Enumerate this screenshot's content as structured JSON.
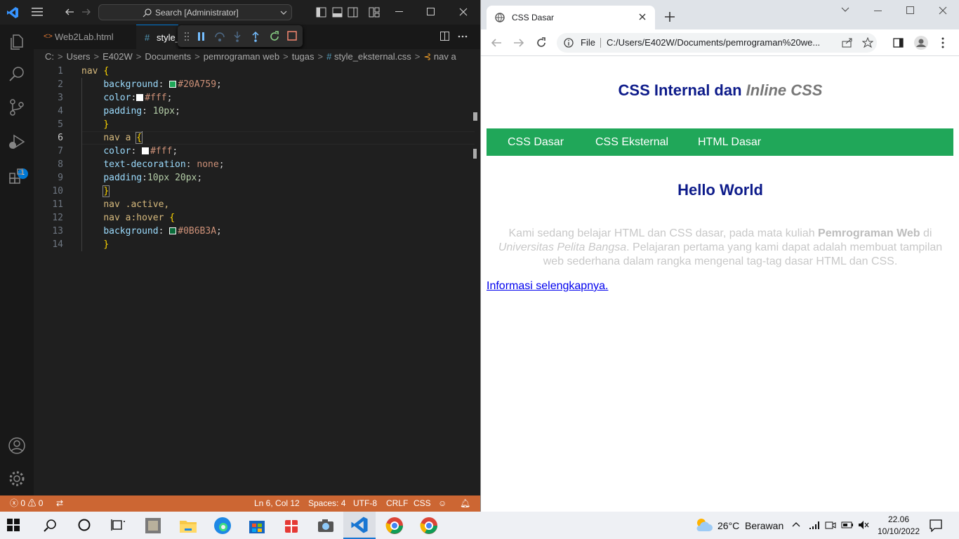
{
  "vscode": {
    "search_placeholder": "Search [Administrator]",
    "debug_badge": "1",
    "tabs": [
      {
        "label": "Web2Lab.html",
        "icon": "<>"
      },
      {
        "label": "style_",
        "icon": "#"
      }
    ],
    "breadcrumb": [
      "C:",
      "Users",
      "E402W",
      "Documents",
      "pemrograman web",
      "tugas",
      "style_eksternal.css",
      "nav a"
    ],
    "code_lines": [
      {
        "n": "1"
      },
      {
        "n": "2"
      },
      {
        "n": "3"
      },
      {
        "n": "4"
      },
      {
        "n": "5"
      },
      {
        "n": "6"
      },
      {
        "n": "7"
      },
      {
        "n": "8"
      },
      {
        "n": "9"
      },
      {
        "n": "10"
      },
      {
        "n": "11"
      },
      {
        "n": "12"
      },
      {
        "n": "13"
      },
      {
        "n": "14"
      }
    ],
    "code": {
      "l1_sel": "nav",
      "l1_br": "{",
      "l2_prop": "background",
      "l2_val": "#20A759",
      "l2_swatch": "#20A759",
      "l3_prop": "color",
      "l3_val": "#fff",
      "l3_swatch": "#ffffff",
      "l4_prop": "padding",
      "l4_val": "10px",
      "l5_br": "}",
      "l6_sel": "nav a",
      "l6_br": "{",
      "l7_prop": "color",
      "l7_val": "#fff",
      "l7_swatch": "#ffffff",
      "l8_prop": "text-decoration",
      "l8_val": "none",
      "l9_prop": "padding",
      "l9_val": "10px 20px",
      "l10_br": "}",
      "l11_sel": "nav .active,",
      "l12_sel": "nav a:hover",
      "l12_br": "{",
      "l13_prop": "background",
      "l13_val": "#0B6B3A",
      "l13_swatch": "#0B6B3A",
      "l14_br": "}"
    },
    "status": {
      "errors": "0",
      "warnings": "0",
      "position": "Ln 6, Col 12",
      "spaces": "Spaces: 4",
      "encoding": "UTF-8",
      "eol": "CRLF",
      "language": "CSS",
      "bar_color": "#cc6633"
    }
  },
  "browser": {
    "tab_title": "CSS Dasar",
    "omnibox_prefix": "File",
    "url": "C:/Users/E402W/Documents/pemrograman%20we...",
    "page": {
      "h1_normal": "CSS Internal dan ",
      "h1_italic": "Inline CSS",
      "nav": [
        "CSS Dasar",
        "CSS Eksternal",
        "HTML Dasar"
      ],
      "nav_color": "#20A759",
      "h2": "Hello World",
      "para_1": "Kami sedang belajar HTML dan CSS dasar, pada mata kuliah ",
      "para_bold": "Pemrograman Web",
      "para_2": " di ",
      "para_italic": "Universitas Pelita Bangsa",
      "para_3": ". Pelajaran pertama yang kami dapat adalah membuat tampilan web sederhana dalam rangka mengenal tag-tag dasar HTML dan CSS.",
      "link": "Informasi selengkapnya."
    }
  },
  "taskbar": {
    "weather_temp": "26°C",
    "weather_desc": "Berawan",
    "time": "22.06",
    "date": "10/10/2022"
  }
}
